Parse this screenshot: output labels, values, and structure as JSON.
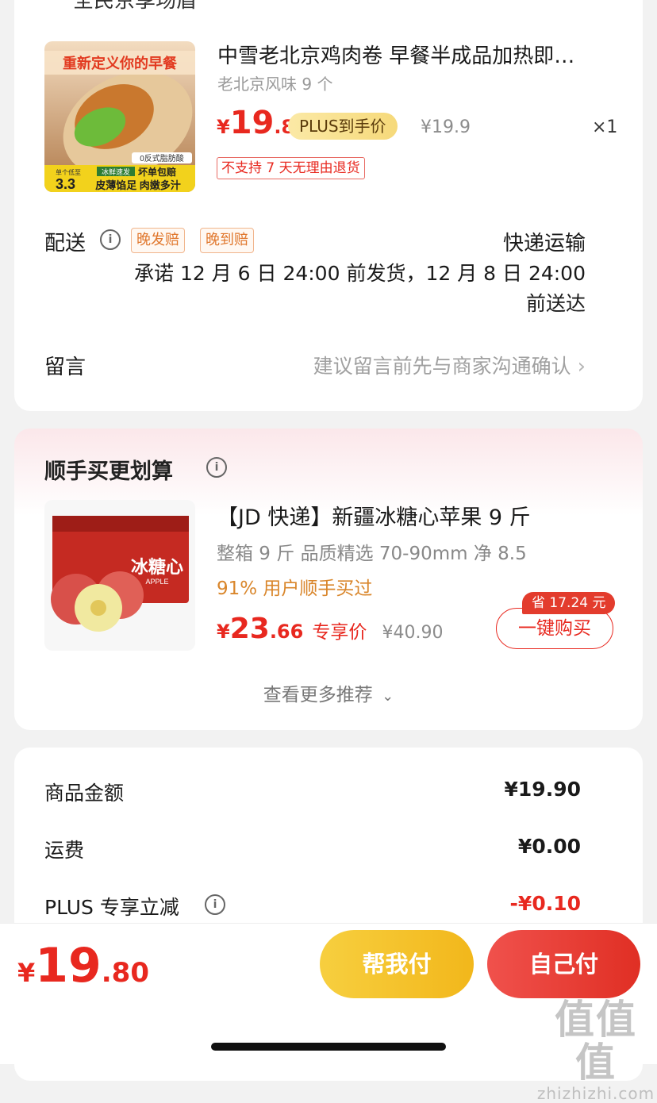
{
  "store": {
    "title": "全民京享场盾"
  },
  "item": {
    "title": "中雪老北京鸡肉卷 早餐半成品加热即…",
    "spec": "老北京风味 9 个",
    "price_symbol": "¥",
    "price_int": "19",
    "price_dec": ".8",
    "plus_label": "PLUS到手价",
    "orig_price": "¥19.9",
    "qty": "×1",
    "no_return": "不支持 7 天无理由退货",
    "image_text": {
      "headline": "重新定义你的早餐",
      "badge": "0反式脂肪酸",
      "unit_price": "3.3",
      "unit_label": "单个低至",
      "tag1": "冰鲜速发",
      "tag2": "坏单包赔",
      "tag3": "皮薄馅足 肉嫩多汁"
    }
  },
  "delivery": {
    "label": "配送",
    "tags": [
      "晚发赔",
      "晚到赔"
    ],
    "method": "快递运输",
    "promise": "承诺 12 月 6 日 24:00 前发货，12 月 8 日 24:00 前送达"
  },
  "note": {
    "label": "留言",
    "hint": "建议留言前先与商家沟通确认"
  },
  "recommend": {
    "title": "顺手买更划算",
    "product": {
      "title": "【JD 快递】新疆冰糖心苹果 9 斤",
      "sub": "整箱 9 斤 品质精选 70-90mm 净 8.5",
      "bought": "91% 用户顺手买过",
      "price_symbol": "¥",
      "price_int": "23",
      "price_dec": ".66",
      "exclusive": "专享价",
      "orig_price": "¥40.90",
      "save": "省 17.24 元",
      "buy": "一键购买",
      "box_text": "冰糖心",
      "box_sub": "APPLE"
    },
    "more": "查看更多推荐"
  },
  "summary": [
    {
      "label": "商品金额",
      "value": "¥19.90",
      "info": false,
      "color": "#1a1a1a"
    },
    {
      "label": "运费",
      "value": "¥0.00",
      "info": false,
      "color": "#1a1a1a"
    },
    {
      "label": "PLUS 专享立减",
      "value": "-¥0.10",
      "info": true,
      "color": "#e8281f"
    }
  ],
  "footer": {
    "total_symbol": "¥",
    "total_int": "19",
    "total_dec": ".80",
    "help_pay": "帮我付",
    "self_pay": "自己付"
  },
  "watermark": {
    "logo": "值值值",
    "site": "zhizhizhi.com"
  }
}
